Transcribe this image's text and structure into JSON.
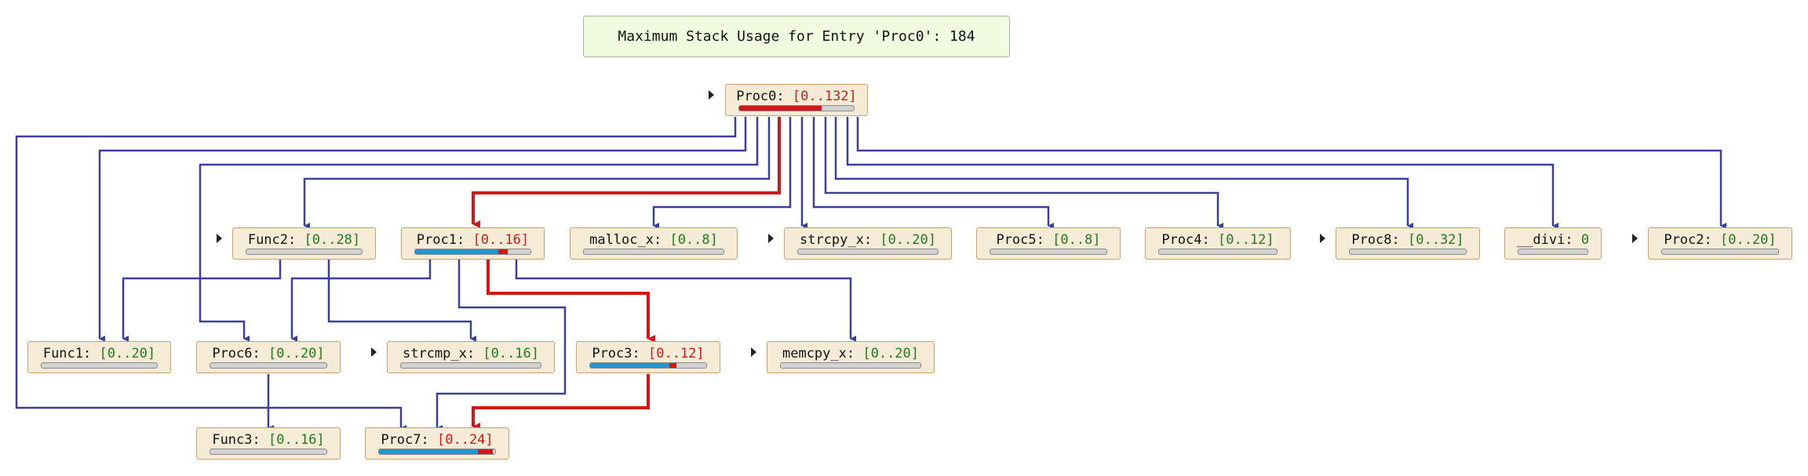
{
  "header": {
    "text": "Maximum Stack Usage for Entry 'Proc0': 184"
  },
  "colors": {
    "edge": "#3b3f99",
    "critical": "#d01818",
    "fill_blue": "#2196d2",
    "range_green": "#1f7a1f",
    "range_red": "#cc1a1a",
    "node_fill": "#f6ebd6"
  },
  "nodes": {
    "proc0": {
      "name": "Proc0:",
      "range": "[0..132]",
      "critical": true,
      "blue": 0.0,
      "red": 0.72
    },
    "func2": {
      "name": "Func2:",
      "range": "[0..28]",
      "critical": false,
      "blue": 0,
      "red": 0
    },
    "proc1": {
      "name": "Proc1:",
      "range": "[0..16]",
      "critical": true,
      "blue": 0.72,
      "red": 0.08
    },
    "malloc_x": {
      "name": "malloc_x:",
      "range": "[0..8]",
      "critical": false,
      "blue": 0,
      "red": 0
    },
    "strcpy_x": {
      "name": "strcpy_x:",
      "range": "[0..20]",
      "critical": false,
      "blue": 0,
      "red": 0
    },
    "proc5": {
      "name": "Proc5:",
      "range": "[0..8]",
      "critical": false,
      "blue": 0,
      "red": 0
    },
    "proc4": {
      "name": "Proc4:",
      "range": "[0..12]",
      "critical": false,
      "blue": 0,
      "red": 0
    },
    "proc8": {
      "name": "Proc8:",
      "range": "[0..32]",
      "critical": false,
      "blue": 0,
      "red": 0
    },
    "divi": {
      "name": "__divi:",
      "range": "0",
      "critical": false,
      "blue": 0,
      "red": 0
    },
    "proc2": {
      "name": "Proc2:",
      "range": "[0..20]",
      "critical": false,
      "blue": 0,
      "red": 0
    },
    "func1": {
      "name": "Func1:",
      "range": "[0..20]",
      "critical": false,
      "blue": 0,
      "red": 0
    },
    "proc6": {
      "name": "Proc6:",
      "range": "[0..20]",
      "critical": false,
      "blue": 0,
      "red": 0
    },
    "strcmp_x": {
      "name": "strcmp_x:",
      "range": "[0..16]",
      "critical": false,
      "blue": 0,
      "red": 0
    },
    "proc3": {
      "name": "Proc3:",
      "range": "[0..12]",
      "critical": true,
      "blue": 0.68,
      "red": 0.06
    },
    "memcpy_x": {
      "name": "memcpy_x:",
      "range": "[0..20]",
      "critical": false,
      "blue": 0,
      "red": 0
    },
    "func3": {
      "name": "Func3:",
      "range": "[0..16]",
      "critical": false,
      "blue": 0,
      "red": 0
    },
    "proc7": {
      "name": "Proc7:",
      "range": "[0..24]",
      "critical": true,
      "blue": 0.85,
      "red": 0.13
    }
  }
}
